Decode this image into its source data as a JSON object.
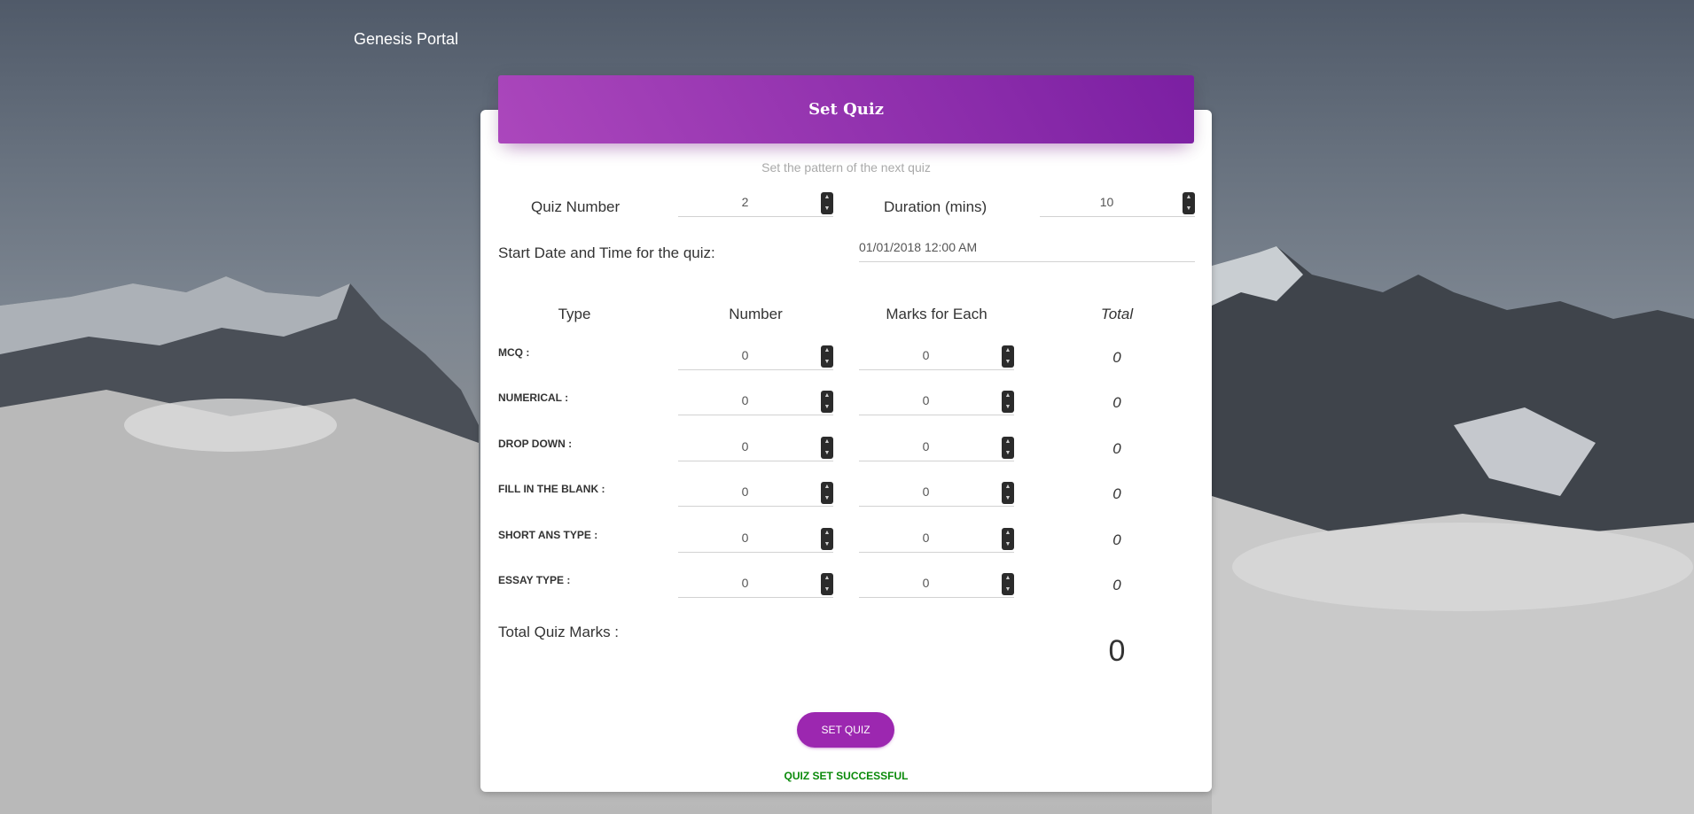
{
  "brand": "Genesis Portal",
  "header": {
    "title": "Set Quiz",
    "subtitle": "Set the pattern of the next quiz"
  },
  "quiz_number": {
    "label": "Quiz Number",
    "value": "2"
  },
  "duration": {
    "label": "Duration (mins)",
    "value": "10"
  },
  "start": {
    "label": "Start Date and Time for the quiz:",
    "value": "01/01/2018 12:00 AM"
  },
  "columns": {
    "type": "Type",
    "number": "Number",
    "marks": "Marks for Each",
    "total": "Total"
  },
  "rows": [
    {
      "label": "MCQ :",
      "number": "0",
      "marks": "0",
      "total": "0"
    },
    {
      "label": "NUMERICAL :",
      "number": "0",
      "marks": "0",
      "total": "0"
    },
    {
      "label": "DROP DOWN :",
      "number": "0",
      "marks": "0",
      "total": "0"
    },
    {
      "label": "FILL IN THE BLANK :",
      "number": "0",
      "marks": "0",
      "total": "0"
    },
    {
      "label": "SHORT ANS TYPE :",
      "number": "0",
      "marks": "0",
      "total": "0"
    },
    {
      "label": "ESSAY TYPE :",
      "number": "0",
      "marks": "0",
      "total": "0"
    }
  ],
  "total_marks": {
    "label": "Total Quiz Marks :",
    "value": "0"
  },
  "button": {
    "label": "SET QUIZ"
  },
  "status": "QUIZ SET SUCCESSFUL",
  "colors": {
    "accent": "#9c27b0",
    "success": "#0a8a0a"
  },
  "icons": {
    "spinner": "number-spinner-icon"
  }
}
